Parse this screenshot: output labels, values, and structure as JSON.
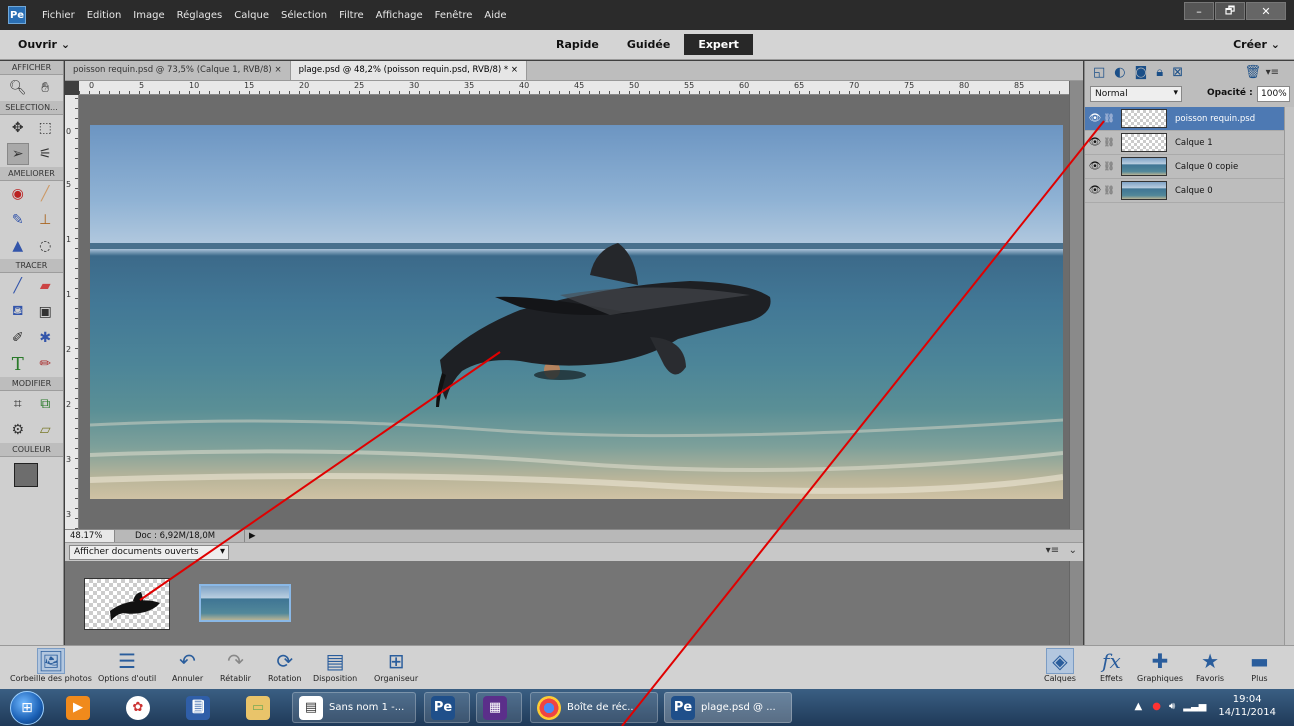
{
  "menubar": {
    "app_icon": "Pe",
    "items": [
      "Fichier",
      "Edition",
      "Image",
      "Réglages",
      "Calque",
      "Sélection",
      "Filtre",
      "Affichage",
      "Fenêtre",
      "Aide"
    ],
    "window_controls": [
      "–",
      "🗗",
      "✕"
    ]
  },
  "modebar": {
    "open_label": "Ouvrir",
    "modes": [
      "Rapide",
      "Guidée",
      "Expert"
    ],
    "active_mode": "Expert",
    "create_label": "Créer"
  },
  "toolbox": {
    "sections": [
      "AFFICHER",
      "SELECTION...",
      "AMELIORER",
      "TRACER",
      "MODIFIER",
      "COULEUR"
    ]
  },
  "documents": {
    "tabs": [
      "poisson requin.psd @ 73,5% (Calque 1, RVB/8)",
      "plage.psd @ 48,2% (poisson requin.psd, RVB/8) *"
    ],
    "close_glyph": "×"
  },
  "rulers": {
    "top_labels": [
      "0",
      "5",
      "10",
      "15",
      "20",
      "25",
      "30",
      "35",
      "40",
      "45",
      "50",
      "55",
      "60",
      "65",
      "70",
      "75",
      "80",
      "85"
    ],
    "left_labels": [
      "0",
      "5",
      "1",
      "1",
      "2",
      "2",
      "3",
      "3"
    ]
  },
  "status": {
    "zoom": "48.17%",
    "doc_info": "Doc : 6,92M/18,0M"
  },
  "photo_bin": {
    "dropdown_value": "Afficher documents ouverts"
  },
  "layers_panel": {
    "blend_mode": "Normal",
    "opacity_label": "Opacité :",
    "opacity_value": "100%",
    "layers": [
      {
        "name": "poisson requin.psd",
        "selected": true,
        "thumb": "transparent"
      },
      {
        "name": "Calque 1",
        "selected": false,
        "thumb": "transparent"
      },
      {
        "name": "Calque 0 copie",
        "selected": false,
        "thumb": "photo"
      },
      {
        "name": "Calque 0",
        "selected": false,
        "thumb": "photo"
      }
    ]
  },
  "bottom_bar": {
    "left_buttons": [
      "Corbeille des photos",
      "Options d'outil",
      "Annuler",
      "Rétablir",
      "Rotation",
      "Disposition",
      "Organiseur"
    ],
    "right_buttons": [
      "Calques",
      "Effets",
      "Graphiques",
      "Favoris",
      "Plus"
    ]
  },
  "taskbar": {
    "windows": [
      "Sans nom 1 -...",
      "Boîte de réc...",
      "plage.psd @ ..."
    ],
    "time": "19:04",
    "date": "14/11/2014"
  },
  "colors": {
    "annotation_red": "#e00000",
    "selected_layer": "#4d79b3",
    "active_mode_bg": "#282828"
  }
}
